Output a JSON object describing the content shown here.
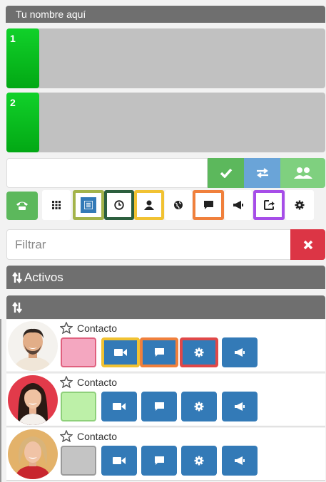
{
  "user": {
    "name": "Tu nombre aquí"
  },
  "lines": [
    {
      "number": "1"
    },
    {
      "number": "2"
    }
  ],
  "filter": {
    "placeholder": "Filtrar"
  },
  "sections": {
    "active": "Activos",
    "all": ""
  },
  "contacts": [
    {
      "label": "Contacto",
      "status_color": "#f4a7c0",
      "status_border": "#e0607e",
      "avatar": "man-avatar"
    },
    {
      "label": "Contacto",
      "status_color": "#bdf0a8",
      "status_border": "#8ed07a",
      "avatar": "woman-avatar"
    },
    {
      "label": "Contacto",
      "status_color": "#c4c4c4",
      "status_border": "#9a9a9a",
      "avatar": "senior-woman-avatar"
    }
  ],
  "colors": {
    "green": "#5cb85c",
    "blue": "#337ab7",
    "red": "#dc3545",
    "header_gray": "#6f6f6f",
    "highlight_olive": "#a3b34a",
    "highlight_darkgreen": "#2c5f3e",
    "highlight_yellow": "#f1c232",
    "highlight_orange": "#f0803c",
    "highlight_purple": "#a64de8",
    "highlight_red": "#e04848"
  }
}
